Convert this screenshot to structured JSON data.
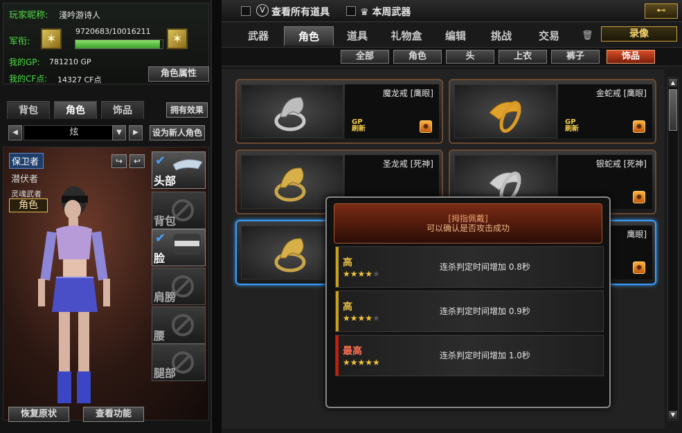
{
  "profile": {
    "nickname_label": "玩家昵称:",
    "nickname": "淺吟游诗人",
    "rank_label": "军衔:",
    "xp_text": "9720683/10016211",
    "xp_fraction": 0.97,
    "gp_label": "我的GP:",
    "gp_value": "781210 GP",
    "cf_label": "我的CF点:",
    "cf_value": "14327 CF点",
    "attr_button": "角色属性"
  },
  "left_tabs": [
    "背包",
    "角色",
    "饰品"
  ],
  "own_effect_button": "拥有效果",
  "selector": {
    "value": "炫",
    "set_new_button": "设为新人角色"
  },
  "classes": [
    "保卫者",
    "潜伏者",
    "灵魂武者"
  ],
  "role_tag": "角色",
  "slots": [
    {
      "label": "头部",
      "filled": true
    },
    {
      "label": "背包",
      "filled": false
    },
    {
      "label": "脸",
      "filled": true
    },
    {
      "label": "肩膀",
      "filled": false
    },
    {
      "label": "腰",
      "filled": false
    },
    {
      "label": "腿部",
      "filled": false
    }
  ],
  "bottom_buttons": {
    "restore": "恢复原状",
    "check": "查看功能"
  },
  "topbar": {
    "view_all": "查看所有道具",
    "weekly": "本周武器"
  },
  "main_tabs": [
    "武器",
    "角色",
    "道具",
    "礼物盒",
    "编辑",
    "挑战",
    "交易"
  ],
  "record_button": "录像",
  "sub_tabs": [
    "全部",
    "角色",
    "头",
    "上衣",
    "裤子",
    "饰品"
  ],
  "items": [
    {
      "name": "魔龙戒 [鹰眼]",
      "badge": "GP\n刷新",
      "metal": "silver"
    },
    {
      "name": "金蛇戒 [鹰眼]",
      "badge": "GP\n刷新",
      "metal": "gold"
    },
    {
      "name": "圣龙戒 [死神]",
      "badge": "",
      "metal": "gold"
    },
    {
      "name": "银蛇戒 [死神]",
      "badge": "",
      "metal": "silver"
    },
    {
      "name": "",
      "badge": "",
      "metal": "gold"
    },
    {
      "name": "鹰眼]",
      "badge": "",
      "metal": "gold"
    }
  ],
  "popup": {
    "title": "[拇指佩戴]",
    "subtitle": "可以确认是否攻击成功",
    "attrs": [
      {
        "level": "高",
        "stars": 4,
        "desc": "连杀判定时间增加 0.8秒"
      },
      {
        "level": "高",
        "stars": 4,
        "desc": "连杀判定时间增加 0.9秒"
      },
      {
        "level": "最高",
        "stars": 5,
        "desc": "连杀判定时间增加 1.0秒"
      }
    ]
  },
  "colors": {
    "accent_orange": "#d8502a",
    "select_blue": "#3aa0ff",
    "gp_green": "#4fdc45",
    "gold": "#f3c838"
  }
}
